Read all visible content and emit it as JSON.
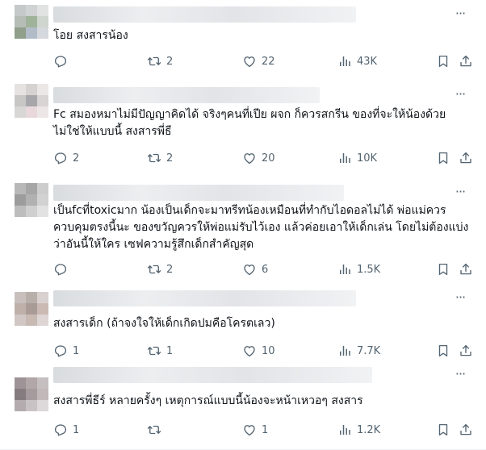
{
  "posts": [
    {
      "text": "โอย สงสารน้อง",
      "replies": "",
      "retweets": "2",
      "likes": "22",
      "views": "43K"
    },
    {
      "text": "Fc สมองหมาไม่มีปัญญาคิดได้ จริงๆคนที่เปีย ผจก ก็ควรสกรีน ของที่จะให้น้องด้วย\nไม่ใช่ให้แบบนี้ สงสารพี่ธี",
      "replies": "2",
      "retweets": "2",
      "likes": "20",
      "views": "10K"
    },
    {
      "text": "เป็นfcที่toxicมาก น้องเป็นเด็กจะมาทรีทน้องเหมือนที่ทำกับไอดอลไม่ได้ พ่อแม่ควร\nควบคุมตรงนี้นะ ของขวัญควรให้พ่อแม่รับไว้เอง แล้วค่อยเอาให้เด็กเล่น โดยไม่ต้องแบ่ง\nว่าอันนี้ให้ใคร เซฟความรู้สึกเด็กสำคัญสุด",
      "replies": "",
      "retweets": "2",
      "likes": "6",
      "views": "1.5K"
    },
    {
      "text": "สงสารเด็ก (ถ้าจงใจให้เด็กเกิดปมคือโครตเลว)",
      "replies": "1",
      "retweets": "1",
      "likes": "10",
      "views": "7.7K"
    },
    {
      "text": "สงสารพี่ธีร์ หลายครั้งๆ เหตุการณ์แบบนี้น้องจะหน้าเหวอๆ สงสาร",
      "replies": "1",
      "retweets": "",
      "likes": "1",
      "views": "1.2K"
    }
  ],
  "icons": {
    "reply": "reply-icon",
    "retweet": "retweet-icon",
    "like": "heart-icon",
    "views": "views-icon",
    "bookmark": "bookmark-icon",
    "share": "share-icon",
    "more": "more-icon"
  },
  "colors": {
    "text": "#0f1419",
    "muted": "#536471",
    "divider": "#eff3f4"
  }
}
